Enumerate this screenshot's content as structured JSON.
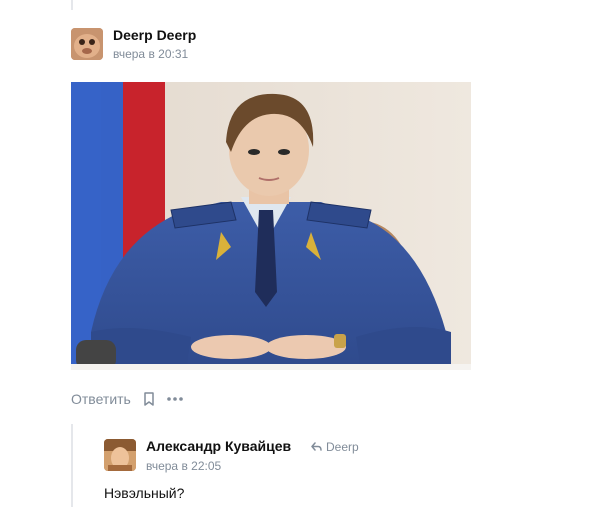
{
  "comment": {
    "author": "Deerp Deerp",
    "time": "вчера в 20:31",
    "actions": {
      "reply_label": "Ответить",
      "bookmark_icon": "bookmark-icon",
      "more_icon": "more-dots-icon"
    }
  },
  "reply": {
    "author": "Александр Кувайцев",
    "reply_to": "Deerp",
    "reply_icon": "reply-arrow-icon",
    "time": "вчера в 22:05",
    "text": "Нэвэльный?"
  },
  "colors": {
    "meta_text": "#818c99",
    "name_text": "#111111",
    "thread_line": "#e5e7eb"
  }
}
